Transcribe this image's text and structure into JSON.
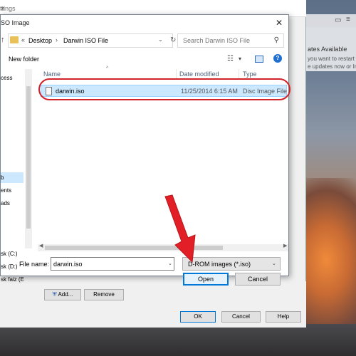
{
  "settings": {
    "title_fragment": "ttings",
    "add_label": "Add...",
    "remove_label": "Remove",
    "ok_label": "OK",
    "cancel_label": "Cancel",
    "help_label": "Help"
  },
  "update_notice": {
    "title": "ates Available",
    "line1": "you want to restart t",
    "line2": "e updates now or Install"
  },
  "dialog": {
    "title": "SO Image",
    "breadcrumb": [
      "Desktop",
      "Darwin ISO File"
    ],
    "search_placeholder": "Search Darwin ISO File",
    "new_folder_label": "New folder",
    "nav_items": [
      "cess",
      "",
      "",
      "",
      "ents",
      "ads",
      "",
      "",
      "",
      "sk (C:)",
      "sk (D:)",
      "sk faiz (E"
    ],
    "columns": {
      "name": "Name",
      "date": "Date modified",
      "type": "Type"
    },
    "files": [
      {
        "name": "darwin.iso",
        "date": "11/25/2014 6:15 AM",
        "type": "Disc Image File"
      }
    ],
    "filename_label": "File name:",
    "filename_value": "darwin.iso",
    "filetype_value": "D-ROM images (*.iso)",
    "open_label": "Open",
    "cancel_label": "Cancel"
  },
  "colors": {
    "highlight": "#d2232a",
    "selection": "#cce8ff",
    "accent": "#0078d7"
  }
}
